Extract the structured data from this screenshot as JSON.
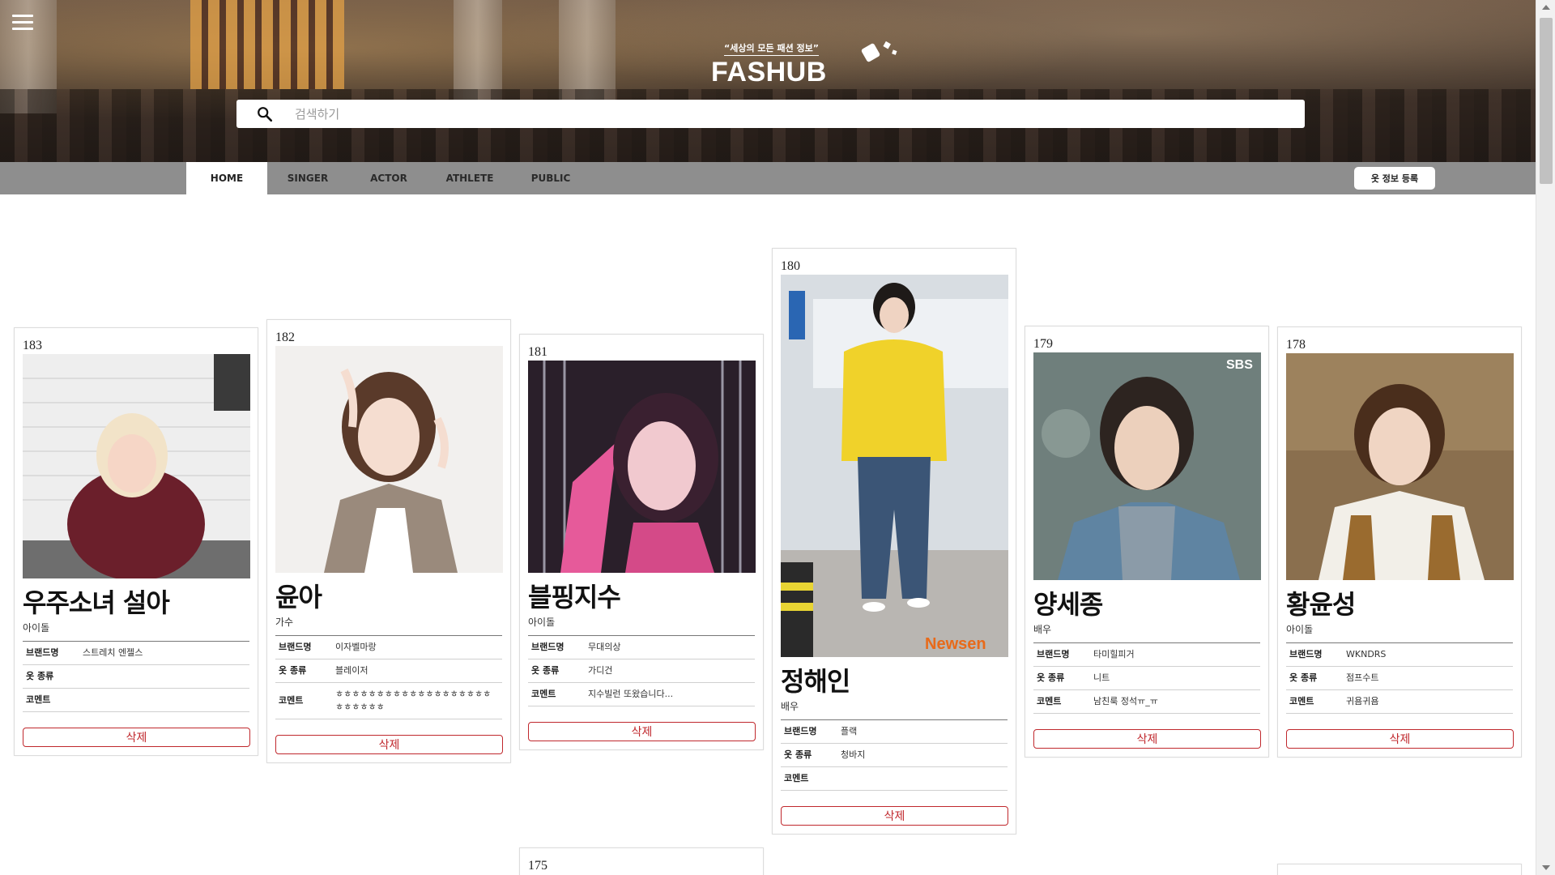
{
  "header": {
    "tagline": "“세상의 모든 패션 정보”",
    "logo": "FASHUB",
    "search_placeholder": "검색하기"
  },
  "nav": {
    "tabs": [
      "HOME",
      "SINGER",
      "ACTOR",
      "ATHLETE",
      "PUBLIC"
    ],
    "active_tab": "HOME",
    "register_label": "옷 정보 등록"
  },
  "labels": {
    "brand": "브랜드명",
    "clothes": "옷 종류",
    "comment": "코멘트",
    "delete": "삭제"
  },
  "cards": [
    {
      "num": "183",
      "name": "우주소녀 설아",
      "category": "아이돌",
      "brand": "스트레치 엔젤스",
      "clothes": "",
      "comment": ""
    },
    {
      "num": "182",
      "name": "윤아",
      "category": "가수",
      "brand": "이자벨마랑",
      "clothes": "블레이저",
      "comment": "ㅎㅎㅎㅎㅎㅎㅎㅎㅎㅎㅎㅎㅎㅎㅎㅎㅎㅎㅎㅎㅎㅎㅎㅎㅎ"
    },
    {
      "num": "181",
      "name": "블핑지수",
      "category": "아이돌",
      "brand": "무대의상",
      "clothes": "가디건",
      "comment": "지수빌런 또왔습니다..."
    },
    {
      "num": "180",
      "name": "정해인",
      "category": "배우",
      "brand": "플랙",
      "clothes": "청바지",
      "comment": ""
    },
    {
      "num": "179",
      "name": "양세종",
      "category": "배우",
      "brand": "타미힐피거",
      "clothes": "니트",
      "comment": "남친룩 정석ㅠ_ㅠ"
    },
    {
      "num": "178",
      "name": "황윤성",
      "category": "아이돌",
      "brand": "WKNDRS",
      "clothes": "점프수트",
      "comment": "귀욤귀욤"
    }
  ],
  "partial_cards": [
    {
      "num": "175"
    }
  ],
  "image_text": {
    "card_180_watermark": "Newsen",
    "card_179_watermark": "SBS"
  },
  "colors": {
    "nav_bg": "#8e8e8e",
    "delete_red": "#c0282d"
  }
}
